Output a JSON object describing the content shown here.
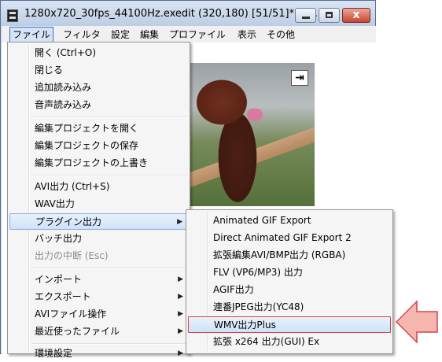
{
  "window": {
    "title": "1280x720_30fps_44100Hz.exedit (320,180)  [51/51]* [0...",
    "close_glyph": "x"
  },
  "menubar": {
    "items": [
      "ファイル",
      "フィルタ",
      "設定",
      "編集",
      "プロファイル",
      "表示",
      "その他"
    ]
  },
  "file_menu": {
    "items": [
      {
        "label": "開く (Ctrl+O)"
      },
      {
        "label": "閉じる"
      },
      {
        "label": "追加読み込み"
      },
      {
        "label": "音声読み込み"
      },
      {
        "label": "編集プロジェクトを開く"
      },
      {
        "label": "編集プロジェクトの保存"
      },
      {
        "label": "編集プロジェクトの上書き"
      },
      {
        "label": "AVI出力 (Ctrl+S)"
      },
      {
        "label": "WAV出力"
      },
      {
        "label": "プラグイン出力",
        "submenu": true,
        "highlighted": true
      },
      {
        "label": "バッチ出力"
      },
      {
        "label": "出力の中断 (Esc)",
        "disabled": true
      },
      {
        "label": "インポート",
        "submenu": true
      },
      {
        "label": "エクスポート",
        "submenu": true
      },
      {
        "label": "AVIファイル操作",
        "submenu": true
      },
      {
        "label": "最近使ったファイル",
        "submenu": true
      },
      {
        "label": "環境設定",
        "submenu": true
      }
    ]
  },
  "plugin_submenu": {
    "items": [
      {
        "label": "Animated GIF Export"
      },
      {
        "label": "Direct Animated GIF Export 2"
      },
      {
        "label": "拡張編集AVI/BMP出力 (RGBA)"
      },
      {
        "label": "FLV (VP6/MP3) 出力"
      },
      {
        "label": "AGIF出力"
      },
      {
        "label": "連番JPEG出力(YC48)"
      },
      {
        "label": "WMV出力Plus",
        "selected": true
      },
      {
        "label": "拡張 x264 出力(GUI) Ex"
      }
    ]
  },
  "icons": {
    "app": "app-film-icon",
    "jump": "jump-to-end-icon",
    "pointer": "arrow-pointer-icon",
    "submenu_arrow": "▶"
  },
  "colors": {
    "selection_border": "#d0474a",
    "pointer_fill": "#f6b6b0"
  }
}
